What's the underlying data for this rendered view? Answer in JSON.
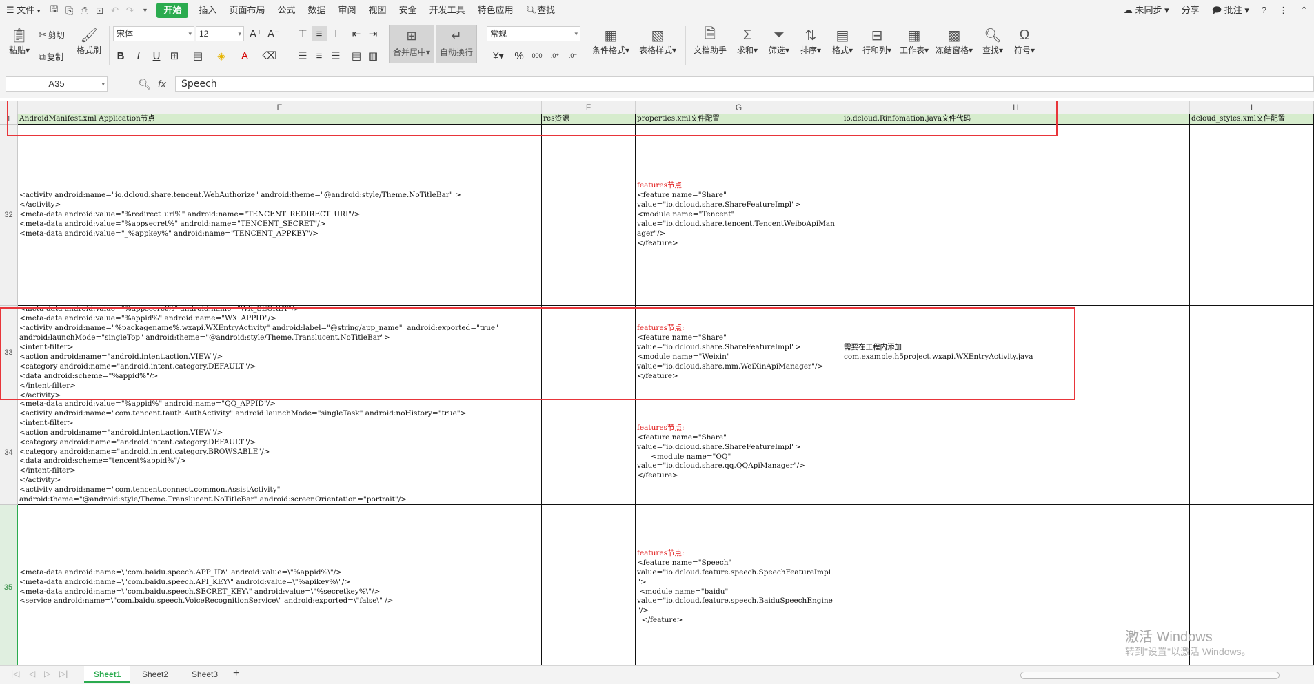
{
  "menubar": {
    "file_label": "文件",
    "tabs": [
      "开始",
      "插入",
      "页面布局",
      "公式",
      "数据",
      "审阅",
      "视图",
      "安全",
      "开发工具",
      "特色应用"
    ],
    "search_label": "查找",
    "right": {
      "sync": "未同步",
      "share": "分享",
      "comment": "批注",
      "help": "?"
    }
  },
  "ribbon": {
    "paste": "粘贴",
    "cut": "剪切",
    "copy": "复制",
    "format_painter": "格式刷",
    "font_name": "宋体",
    "font_size": "12",
    "merge_center": "合并居中",
    "wrap_text": "自动换行",
    "number_format": "常规",
    "cond_format": "条件格式",
    "table_style": "表格样式",
    "doc_helper": "文档助手",
    "sum": "求和",
    "filter": "筛选",
    "sort": "排序",
    "format": "格式",
    "row_col": "行和列",
    "worksheet": "工作表",
    "freeze": "冻结窗格",
    "find": "查找",
    "symbol": "符号"
  },
  "formula_bar": {
    "cell_ref": "A35",
    "fx": "fx",
    "value": "Speech"
  },
  "columns": {
    "E": "E",
    "F": "F",
    "G": "G",
    "H": "H",
    "I": "I"
  },
  "header_row": {
    "num": "1",
    "E": "AndroidManifest.xml Application节点",
    "F": "res资源",
    "G": "properties.xml文件配置",
    "H": "io.dcloud.Rinfomation.java文件代码",
    "I": "dcloud_styles.xml文件配置"
  },
  "rows": [
    {
      "num": "32",
      "E": "<activity android:name=\"io.dcloud.share.tencent.WebAuthorize\" android:theme=\"@android:style/Theme.NoTitleBar\" >\n</activity>\n<meta-data android:value=\"%redirect_uri%\" android:name=\"TENCENT_REDIRECT_URI\"/>\n<meta-data android:value=\"%appsecret%\" android:name=\"TENCENT_SECRET\"/>\n<meta-data android:value=\"_%appkey%\" android:name=\"TENCENT_APPKEY\"/>",
      "G_red": "features节点",
      "G": "<feature name=\"Share\"\nvalue=\"io.dcloud.share.ShareFeatureImpl\">\n<module name=\"Tencent\"\nvalue=\"io.dcloud.share.tencent.TencentWeiboApiMan\nager\"/>\n</feature>",
      "H": ""
    },
    {
      "num": "33",
      "E": "<meta-data android:value=\"%appsecret%\" android:name=\"WX_SECRET\"/>\n<meta-data android:value=\"%appid%\" android:name=\"WX_APPID\"/>\n<activity android:name=\"%packagename%.wxapi.WXEntryActivity\" android:label=\"@string/app_name\"  android:exported=\"true\"\nandroid:launchMode=\"singleTop\" android:theme=\"@android:style/Theme.Translucent.NoTitleBar\">\n<intent-filter>\n<action android:name=\"android.intent.action.VIEW\"/>\n<category android:name=\"android.intent.category.DEFAULT\"/>\n<data android:scheme=\"%appid%\"/>\n</intent-filter>\n</activity>",
      "G_red": "features节点:",
      "G": "<feature name=\"Share\"\nvalue=\"io.dcloud.share.ShareFeatureImpl\">\n<module name=\"Weixin\"\nvalue=\"io.dcloud.share.mm.WeiXinApiManager\"/>\n</feature>",
      "H": "需要在工程内添加\ncom.example.h5project.wxapi.WXEntryActivity.java"
    },
    {
      "num": "34",
      "E": "<meta-data android:value=\"%appid%\" android:name=\"QQ_APPID\"/>\n<activity android:name=\"com.tencent.tauth.AuthActivity\" android:launchMode=\"singleTask\" android:noHistory=\"true\">\n<intent-filter>\n<action android:name=\"android.intent.action.VIEW\"/>\n<category android:name=\"android.intent.category.DEFAULT\"/>\n<category android:name=\"android.intent.category.BROWSABLE\"/>\n<data android:scheme=\"tencent%appid%\"/>\n</intent-filter>\n</activity>\n<activity android:name=\"com.tencent.connect.common.AssistActivity\"\nandroid:theme=\"@android:style/Theme.Translucent.NoTitleBar\" android:screenOrientation=\"portrait\"/>",
      "G_red": "features节点:",
      "G": "<feature name=\"Share\"\nvalue=\"io.dcloud.share.ShareFeatureImpl\">\n      <module name=\"QQ\"\nvalue=\"io.dcloud.share.qq.QQApiManager\"/>\n</feature>",
      "H": ""
    },
    {
      "num": "35",
      "E": "<meta-data android:name=\\\"com.baidu.speech.APP_ID\\\" android:value=\\\"%appid%\\\"/>\n<meta-data android:name=\\\"com.baidu.speech.API_KEY\\\" android:value=\\\"%apikey%\\\"/>\n<meta-data android:name=\\\"com.baidu.speech.SECRET_KEY\\\" android:value=\\\"%secretkey%\\\"/>\n<service android:name=\\\"com.baidu.speech.VoiceRecognitionService\\\" android:exported=\\\"false\\\" />",
      "G_red": "features节点:",
      "G": "<feature name=\"Speech\"\nvalue=\"io.dcloud.feature.speech.SpeechFeatureImpl\n\">\n <module name=\"baidu\"\nvalue=\"io.dcloud.feature.speech.BaiduSpeechEngine\n\"/>\n  </feature>",
      "H": ""
    }
  ],
  "watermark": {
    "line1": "激活 Windows",
    "line2": "转到\"设置\"以激活 Windows。"
  },
  "sheets": [
    "Sheet1",
    "Sheet2",
    "Sheet3"
  ],
  "colors": {
    "accent": "#2bab4f",
    "header_fill": "#d6eccd",
    "highlight_box": "#e8353a",
    "feature_red": "#e01515"
  }
}
